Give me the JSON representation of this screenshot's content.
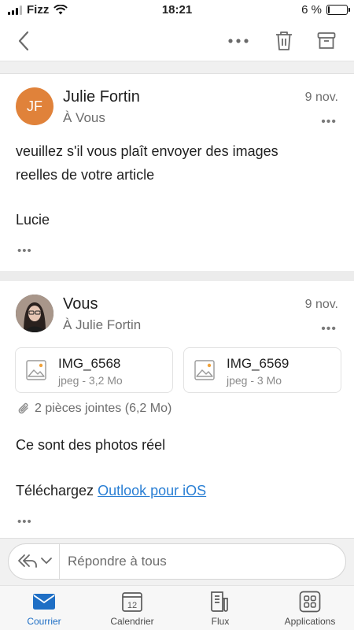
{
  "status_bar": {
    "carrier": "Fizz",
    "time": "18:21",
    "battery_text": "6 %",
    "battery_level": 0.06,
    "icons": [
      "signal-icon",
      "wifi-icon",
      "battery-icon"
    ]
  },
  "toolbar": {
    "icons": [
      "back-chevron-icon",
      "more-horizontal-icon",
      "trash-icon",
      "archive-icon"
    ]
  },
  "messages": [
    {
      "avatar_initials": "JF",
      "avatar_color": "#e0823a",
      "sender": "Julie Fortin",
      "recipient": "À Vous",
      "date": "9 nov.",
      "more": "•••",
      "body_lines": [
        "veuillez s'il vous plaît envoyer des images",
        "reelles de votre article"
      ],
      "signature": "Lucie",
      "trimmed": "•••"
    },
    {
      "avatar_type": "photo",
      "sender": "Vous",
      "recipient": "À Julie Fortin",
      "date": "9 nov.",
      "more": "•••",
      "attachments": [
        {
          "name": "IMG_6568",
          "meta": "jpeg - 3,2 Mo",
          "icon": "image-file-icon"
        },
        {
          "name": "IMG_6569",
          "meta": "jpeg - 3 Mo",
          "icon": "image-file-icon"
        }
      ],
      "attachments_summary": "2 pièces jointes (6,2 Mo)",
      "body_line": "Ce sont des photos réel",
      "download_prefix": "Téléchargez",
      "download_link": "Outlook pour iOS",
      "trimmed": "•••"
    }
  ],
  "reply_bar": {
    "placeholder": "Répondre à tous",
    "icons": [
      "reply-all-icon",
      "chevron-down-icon"
    ]
  },
  "tab_bar": {
    "tabs": [
      {
        "label": "Courrier",
        "icon": "mail-icon",
        "active": true
      },
      {
        "label": "Calendrier",
        "icon": "calendar-icon",
        "active": false,
        "badge": "12"
      },
      {
        "label": "Flux",
        "icon": "feed-icon",
        "active": false
      },
      {
        "label": "Applications",
        "icon": "apps-grid-icon",
        "active": false
      }
    ]
  },
  "colors": {
    "accent": "#1f6fc5",
    "link": "#2a7fd4",
    "avatar_jf": "#e0823a"
  }
}
